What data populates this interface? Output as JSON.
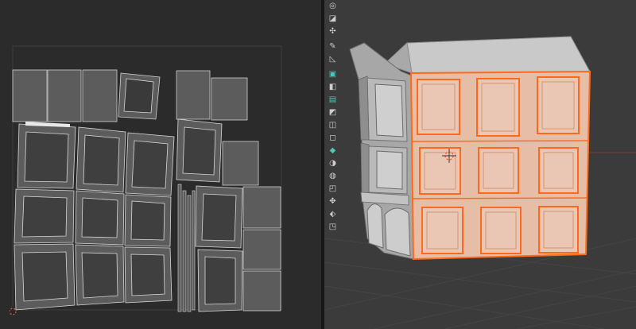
{
  "app": {
    "left_editor": "uv-editor",
    "right_editor": "3d-viewport"
  },
  "colors": {
    "uv_background": "#2b2b2b",
    "uv_island_fill": "#5c5c5c",
    "uv_edge": "#d8d8d8",
    "viewport_background": "#3b3b3b",
    "selection_orange": "#ff6a1a",
    "selected_face": "#e6bda6",
    "mesh_grey": "#b7b7b7"
  },
  "toolbar": {
    "tools": [
      {
        "icon": "cursor-icon"
      },
      {
        "icon": "select-box-icon"
      },
      {
        "icon": "move-icon"
      },
      {
        "icon": "annotate-icon"
      },
      {
        "icon": "measure-icon"
      },
      {
        "icon": "add-cube-icon"
      },
      {
        "icon": "extrude-icon"
      },
      {
        "icon": "inset-icon"
      },
      {
        "icon": "bevel-icon"
      },
      {
        "icon": "loop-cut-icon"
      },
      {
        "icon": "knife-icon"
      },
      {
        "icon": "poly-build-icon"
      },
      {
        "icon": "spin-icon"
      },
      {
        "icon": "smooth-icon"
      },
      {
        "icon": "edge-slide-icon"
      },
      {
        "icon": "shrink-fatten-icon"
      },
      {
        "icon": "shear-icon"
      },
      {
        "icon": "rip-icon"
      }
    ]
  }
}
